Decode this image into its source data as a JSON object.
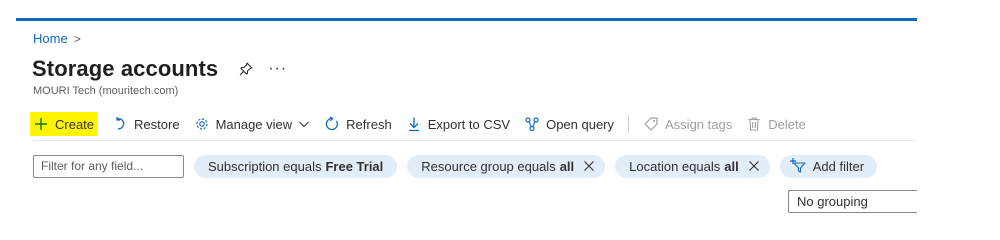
{
  "breadcrumb": {
    "home": "Home",
    "separator": ">"
  },
  "page": {
    "title": "Storage accounts",
    "more": "···",
    "subtitle": "MOURI Tech (mouritech.com)"
  },
  "toolbar": {
    "create": "Create",
    "restore": "Restore",
    "manage_view": "Manage view",
    "refresh": "Refresh",
    "export": "Export to CSV",
    "open_query": "Open query",
    "assign_tags": "Assign tags",
    "delete": "Delete"
  },
  "filters": {
    "placeholder": "Filter for any field...",
    "subscription": {
      "label": "Subscription equals",
      "value": "Free Trial"
    },
    "resource_group": {
      "label": "Resource group equals",
      "value": "all"
    },
    "location": {
      "label": "Location equals",
      "value": "all"
    },
    "add_filter": "Add filter"
  },
  "grouping": {
    "selected": "No grouping"
  },
  "colors": {
    "accent": "#0f6cbd",
    "highlight": "#fff500",
    "pill": "#e1edf8"
  }
}
